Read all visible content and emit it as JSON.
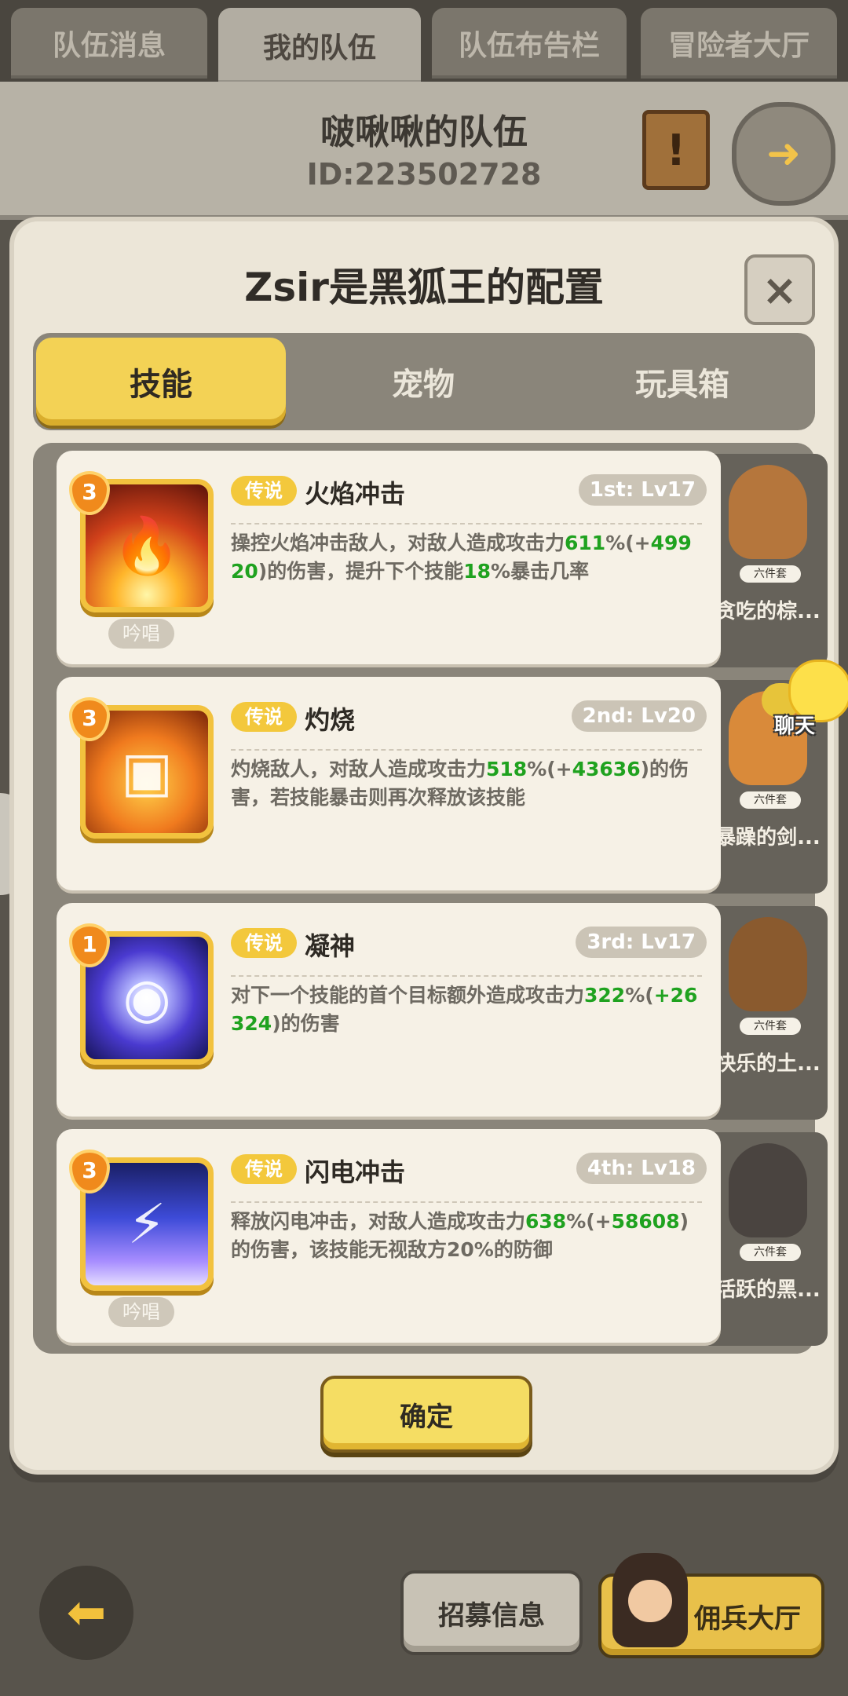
{
  "top_tabs": [
    {
      "label": "队伍消息"
    },
    {
      "label": "我的队伍"
    },
    {
      "label": "队伍布告栏"
    },
    {
      "label": "冒险者大厅"
    }
  ],
  "team": {
    "name": "啵啾啾的队伍",
    "id": "ID:223502728"
  },
  "dialog": {
    "title": "Zsir是黑狐王的配置",
    "tabs": [
      {
        "label": "技能"
      },
      {
        "label": "宠物"
      },
      {
        "label": "玩具箱"
      }
    ],
    "confirm_label": "确定"
  },
  "skills": [
    {
      "level": "3",
      "rarity": "传说",
      "name": "火焰冲击",
      "slot": "1st: Lv17",
      "tag": "吟唱",
      "icon": "flame-burst-icon",
      "desc": [
        {
          "t": "操控火焰冲击敌人，对敌人造成攻击力"
        },
        {
          "t": "611",
          "g": true
        },
        {
          "t": "%(+"
        },
        {
          "t": "49920",
          "g": true
        },
        {
          "t": ")的伤害，提升下个技能"
        },
        {
          "t": "18",
          "g": true
        },
        {
          "t": "%暴击几率"
        }
      ]
    },
    {
      "level": "3",
      "rarity": "传说",
      "name": "灼烧",
      "slot": "2nd: Lv20",
      "tag": "",
      "icon": "burning-figure-icon",
      "desc": [
        {
          "t": "灼烧敌人，对敌人造成攻击力"
        },
        {
          "t": "518",
          "g": true
        },
        {
          "t": "%(+"
        },
        {
          "t": "43636",
          "g": true
        },
        {
          "t": ")的伤害，若技能暴击则再次释放该技能"
        }
      ]
    },
    {
      "level": "1",
      "rarity": "传说",
      "name": "凝神",
      "slot": "3rd: Lv17",
      "tag": "",
      "icon": "focus-eye-icon",
      "desc": [
        {
          "t": "对下一个技能的首个目标额外造成攻击力"
        },
        {
          "t": "322",
          "g": true
        },
        {
          "t": "%("
        },
        {
          "t": "+26324",
          "g": true
        },
        {
          "t": ")的伤害"
        }
      ]
    },
    {
      "level": "3",
      "rarity": "传说",
      "name": "闪电冲击",
      "slot": "4th: Lv18",
      "tag": "吟唱",
      "icon": "lightning-strike-icon",
      "desc": [
        {
          "t": "释放闪电冲击，对敌人造成攻击力"
        },
        {
          "t": "638",
          "g": true
        },
        {
          "t": "%(+"
        },
        {
          "t": "58608",
          "g": true
        },
        {
          "t": ")的伤害，该技能无视敌方20%的防御"
        }
      ]
    }
  ],
  "pets": [
    {
      "name": "贪吃的棕...",
      "badge": "六件套",
      "color": "#b5763c"
    },
    {
      "name": "暴躁的剑...",
      "badge": "六件套",
      "color": "#d98a3a"
    },
    {
      "name": "快乐的土...",
      "badge": "六件套",
      "color": "#8a5a2e"
    },
    {
      "name": "活跃的黑...",
      "badge": "六件套",
      "color": "#4a4440"
    }
  ],
  "chat": {
    "label": "聊天"
  },
  "bottom": {
    "recruit_label": "招募信息",
    "mercenary_label": "佣兵大厅"
  },
  "colors": {
    "accent_yellow": "#f3d255",
    "value_green": "#1fa21f",
    "level_orange": "#f08a1c"
  }
}
